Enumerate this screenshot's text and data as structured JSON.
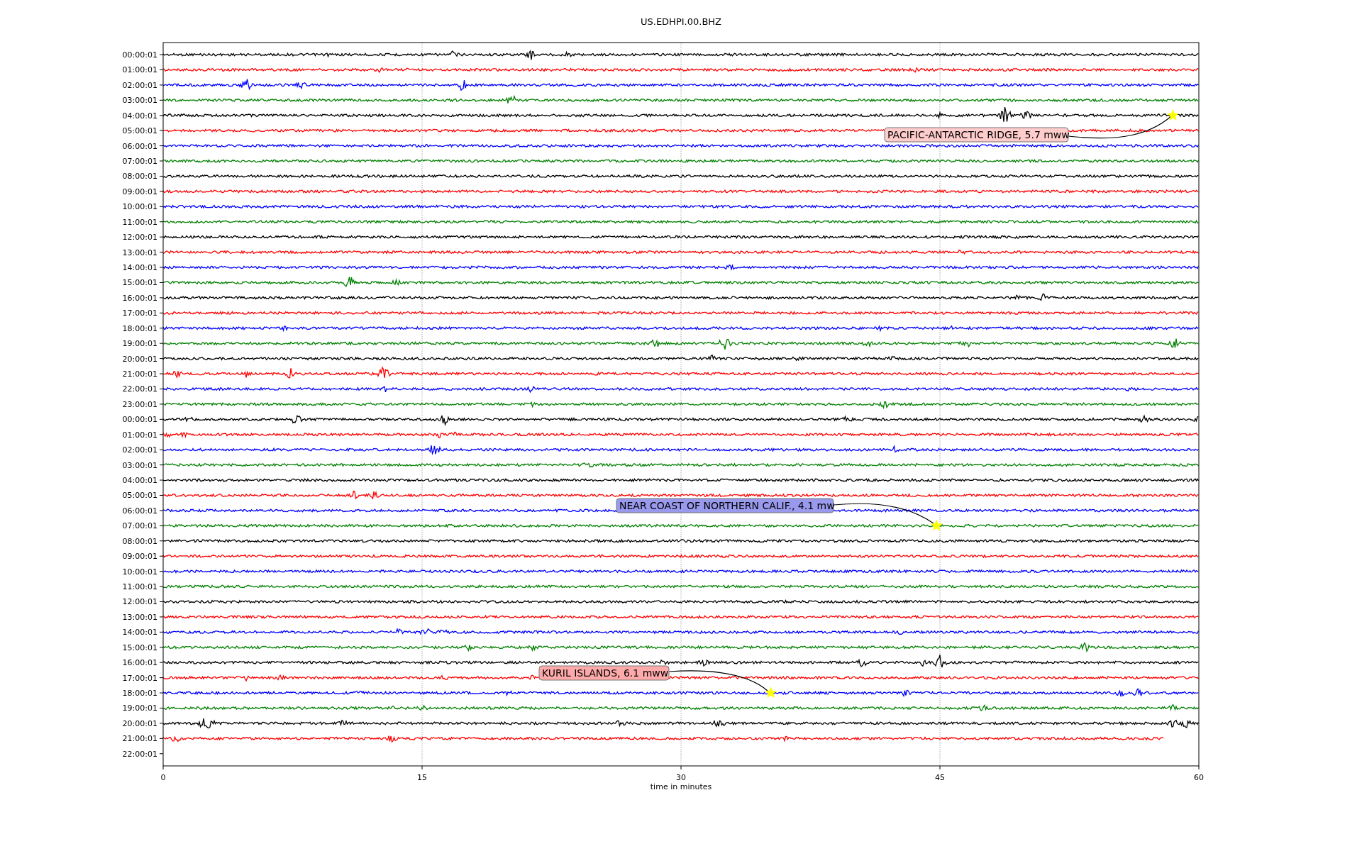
{
  "title": "US.EDHPI.00.BHZ",
  "plot": {
    "rows": [
      {
        "label": "00:00:01",
        "color": "#000000"
      },
      {
        "label": "01:00:01",
        "color": "#ff0000"
      },
      {
        "label": "02:00:01",
        "color": "#0000ff"
      },
      {
        "label": "03:00:01",
        "color": "#008000"
      },
      {
        "label": "04:00:01",
        "color": "#000000"
      },
      {
        "label": "05:00:01",
        "color": "#ff0000"
      },
      {
        "label": "06:00:01",
        "color": "#0000ff"
      },
      {
        "label": "07:00:01",
        "color": "#008000"
      },
      {
        "label": "08:00:01",
        "color": "#000000"
      },
      {
        "label": "09:00:01",
        "color": "#ff0000"
      },
      {
        "label": "10:00:01",
        "color": "#0000ff"
      },
      {
        "label": "11:00:01",
        "color": "#008000"
      },
      {
        "label": "12:00:01",
        "color": "#000000"
      },
      {
        "label": "13:00:01",
        "color": "#ff0000"
      },
      {
        "label": "14:00:01",
        "color": "#0000ff"
      },
      {
        "label": "15:00:01",
        "color": "#008000"
      },
      {
        "label": "16:00:01",
        "color": "#000000"
      },
      {
        "label": "17:00:01",
        "color": "#ff0000"
      },
      {
        "label": "18:00:01",
        "color": "#0000ff"
      },
      {
        "label": "19:00:01",
        "color": "#008000"
      },
      {
        "label": "20:00:01",
        "color": "#000000"
      },
      {
        "label": "21:00:01",
        "color": "#ff0000"
      },
      {
        "label": "22:00:01",
        "color": "#0000ff"
      },
      {
        "label": "23:00:01",
        "color": "#008000"
      },
      {
        "label": "00:00:01",
        "color": "#000000"
      },
      {
        "label": "01:00:01",
        "color": "#ff0000"
      },
      {
        "label": "02:00:01",
        "color": "#0000ff"
      },
      {
        "label": "03:00:01",
        "color": "#008000"
      },
      {
        "label": "04:00:01",
        "color": "#000000"
      },
      {
        "label": "05:00:01",
        "color": "#ff0000"
      },
      {
        "label": "06:00:01",
        "color": "#0000ff"
      },
      {
        "label": "07:00:01",
        "color": "#008000"
      },
      {
        "label": "08:00:01",
        "color": "#000000"
      },
      {
        "label": "09:00:01",
        "color": "#ff0000"
      },
      {
        "label": "10:00:01",
        "color": "#0000ff"
      },
      {
        "label": "11:00:01",
        "color": "#008000"
      },
      {
        "label": "12:00:01",
        "color": "#000000"
      },
      {
        "label": "13:00:01",
        "color": "#ff0000"
      },
      {
        "label": "14:00:01",
        "color": "#0000ff"
      },
      {
        "label": "15:00:01",
        "color": "#008000"
      },
      {
        "label": "16:00:01",
        "color": "#000000"
      },
      {
        "label": "17:00:01",
        "color": "#ff0000"
      },
      {
        "label": "18:00:01",
        "color": "#0000ff"
      },
      {
        "label": "19:00:01",
        "color": "#008000"
      },
      {
        "label": "20:00:01",
        "color": "#000000"
      },
      {
        "label": "21:00:01",
        "color": "#ff0000"
      },
      {
        "label": "22:00:01"
      }
    ],
    "xticks": [
      "0",
      "15",
      "30",
      "45",
      "60"
    ],
    "xlabel": "time in minutes",
    "events": [
      {
        "text": "PACIFIC-ANTARCTIC RIDGE, 5.7 mww",
        "color": "#ffcccc"
      },
      {
        "text": "NEAR COAST OF NORTHERN CALIF., 4.1 mw",
        "color": "#9999ee"
      },
      {
        "text": "KURIL ISLANDS, 6.1 mww",
        "color": "#ffaaaa"
      }
    ]
  }
}
